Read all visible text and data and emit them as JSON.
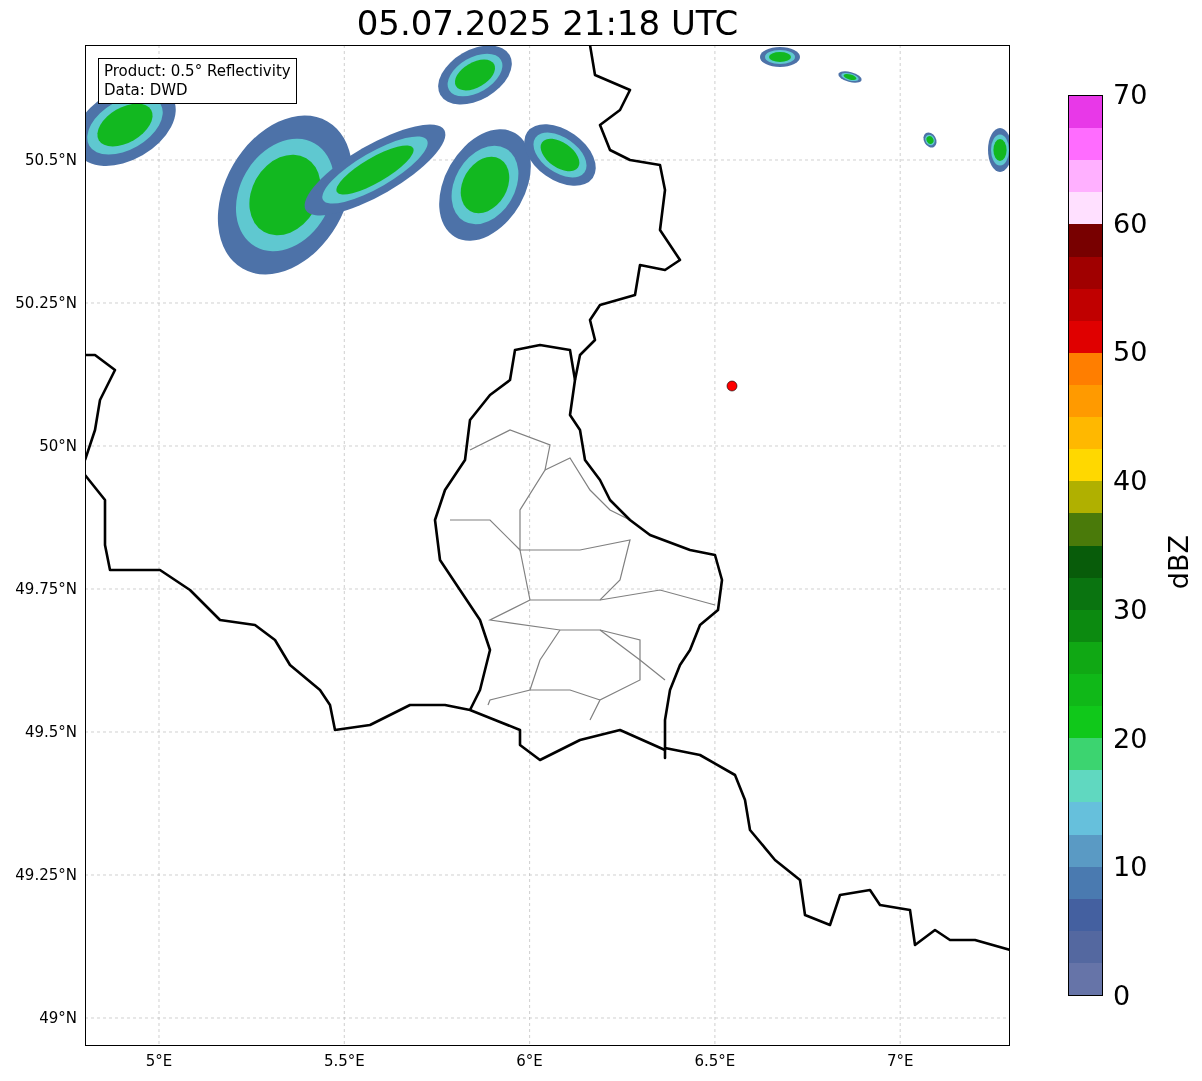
{
  "title": "05.07.2025 21:18 UTC",
  "legend": [
    "Product: 0.5° Reflectivity",
    "Data: DWD"
  ],
  "axes": {
    "y_ticks": [
      "50.5°N",
      "50.25°N",
      "50°N",
      "49.75°N",
      "49.5°N",
      "49.25°N",
      "49°N"
    ],
    "x_ticks": [
      "5°E",
      "5.5°E",
      "6°E",
      "6.5°E",
      "7°E"
    ]
  },
  "marker": {
    "color": "#ff0000"
  },
  "colorbar": {
    "label": "dBZ",
    "ticks": [
      "70",
      "60",
      "50",
      "40",
      "30",
      "20",
      "10",
      "0"
    ],
    "segments": [
      {
        "color": "#e838e8"
      },
      {
        "color": "#ff6cff"
      },
      {
        "color": "#ffb0ff"
      },
      {
        "color": "#ffe0ff"
      },
      {
        "color": "#780000"
      },
      {
        "color": "#a00000"
      },
      {
        "color": "#c00000"
      },
      {
        "color": "#e00000"
      },
      {
        "color": "#ff7e00"
      },
      {
        "color": "#ff9a00"
      },
      {
        "color": "#ffb800"
      },
      {
        "color": "#ffd800"
      },
      {
        "color": "#b0b000"
      },
      {
        "color": "#4a7a0a"
      },
      {
        "color": "#085c0a"
      },
      {
        "color": "#0a7410"
      },
      {
        "color": "#0c8a10"
      },
      {
        "color": "#10a814"
      },
      {
        "color": "#10b818"
      },
      {
        "color": "#10c81a"
      },
      {
        "color": "#3cd470"
      },
      {
        "color": "#60d8c0"
      },
      {
        "color": "#66c0dc"
      },
      {
        "color": "#5a9ac4"
      },
      {
        "color": "#4a7ab0"
      },
      {
        "color": "#4460a0"
      },
      {
        "color": "#5468a0"
      },
      {
        "color": "#6674a8"
      }
    ]
  }
}
